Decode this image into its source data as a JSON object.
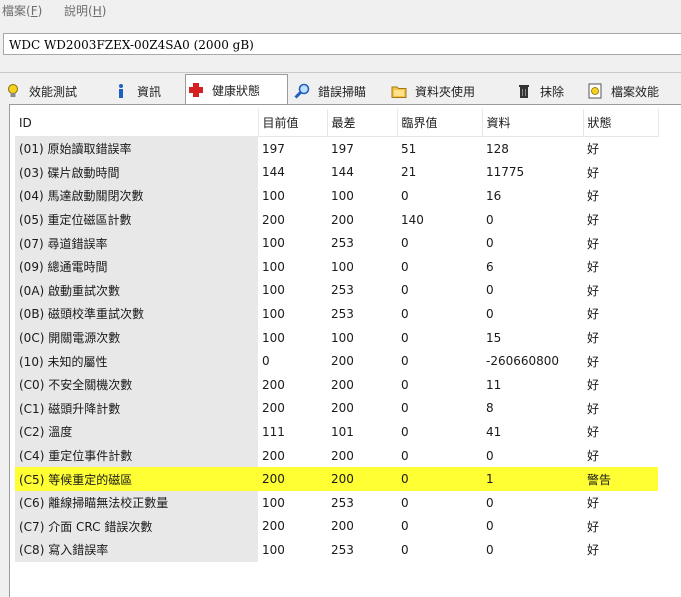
{
  "menu": [
    {
      "label": "檔案(",
      "hotkey": "F",
      "suffix": ")"
    },
    {
      "label": "說明(",
      "hotkey": "H",
      "suffix": ")"
    }
  ],
  "drive": {
    "name": "WDC WD2003FZEX-00Z4SA0 (2000 gB)"
  },
  "tabs": [
    {
      "label": "效能測試",
      "icon": "lightbulb-icon",
      "active": false
    },
    {
      "label": "資訊",
      "icon": "info-icon",
      "active": false
    },
    {
      "label": "健康狀態",
      "icon": "red-cross-icon",
      "active": true
    },
    {
      "label": "錯誤掃瞄",
      "icon": "magnifier-icon",
      "active": false
    },
    {
      "label": "資料夾使用",
      "icon": "folder-icon",
      "active": false
    },
    {
      "label": "抹除",
      "icon": "trash-icon",
      "active": false
    },
    {
      "label": "檔案效能",
      "icon": "file-benchmark-icon",
      "active": false
    }
  ],
  "table": {
    "headers": [
      "ID",
      "目前值",
      "最差",
      "臨界值",
      "資料",
      "狀態"
    ],
    "rows": [
      {
        "id": "(01) 原始讀取錯誤率",
        "current": "197",
        "worst": "197",
        "threshold": "51",
        "raw": "128",
        "status": "好",
        "warning": false
      },
      {
        "id": "(03) 碟片啟動時間",
        "current": "144",
        "worst": "144",
        "threshold": "21",
        "raw": "11775",
        "status": "好",
        "warning": false
      },
      {
        "id": "(04) 馬達啟動關閉次數",
        "current": "100",
        "worst": "100",
        "threshold": "0",
        "raw": "16",
        "status": "好",
        "warning": false
      },
      {
        "id": "(05) 重定位磁區計數",
        "current": "200",
        "worst": "200",
        "threshold": "140",
        "raw": "0",
        "status": "好",
        "warning": false
      },
      {
        "id": "(07) 尋道錯誤率",
        "current": "100",
        "worst": "253",
        "threshold": "0",
        "raw": "0",
        "status": "好",
        "warning": false
      },
      {
        "id": "(09) 總通電時間",
        "current": "100",
        "worst": "100",
        "threshold": "0",
        "raw": "6",
        "status": "好",
        "warning": false
      },
      {
        "id": "(0A) 啟動重試次數",
        "current": "100",
        "worst": "253",
        "threshold": "0",
        "raw": "0",
        "status": "好",
        "warning": false
      },
      {
        "id": "(0B) 磁頭校準重試次數",
        "current": "100",
        "worst": "253",
        "threshold": "0",
        "raw": "0",
        "status": "好",
        "warning": false
      },
      {
        "id": "(0C) 開關電源次數",
        "current": "100",
        "worst": "100",
        "threshold": "0",
        "raw": "15",
        "status": "好",
        "warning": false
      },
      {
        "id": "(10) 未知的屬性",
        "current": "0",
        "worst": "200",
        "threshold": "0",
        "raw": "-260660800",
        "status": "好",
        "warning": false
      },
      {
        "id": "(C0) 不安全關機次數",
        "current": "200",
        "worst": "200",
        "threshold": "0",
        "raw": "11",
        "status": "好",
        "warning": false
      },
      {
        "id": "(C1) 磁頭升降計數",
        "current": "200",
        "worst": "200",
        "threshold": "0",
        "raw": "8",
        "status": "好",
        "warning": false
      },
      {
        "id": "(C2) 溫度",
        "current": "111",
        "worst": "101",
        "threshold": "0",
        "raw": "41",
        "status": "好",
        "warning": false
      },
      {
        "id": "(C4) 重定位事件計數",
        "current": "200",
        "worst": "200",
        "threshold": "0",
        "raw": "0",
        "status": "好",
        "warning": false
      },
      {
        "id": "(C5) 等候重定的磁區",
        "current": "200",
        "worst": "200",
        "threshold": "0",
        "raw": "1",
        "status": "警告",
        "warning": true
      },
      {
        "id": "(C6) 離線掃瞄無法校正數量",
        "current": "100",
        "worst": "253",
        "threshold": "0",
        "raw": "0",
        "status": "好",
        "warning": false
      },
      {
        "id": "(C7) 介面 CRC 錯誤次數",
        "current": "200",
        "worst": "200",
        "threshold": "0",
        "raw": "0",
        "status": "好",
        "warning": false
      },
      {
        "id": "(C8) 寫入錯誤率",
        "current": "100",
        "worst": "253",
        "threshold": "0",
        "raw": "0",
        "status": "好",
        "warning": false
      }
    ]
  },
  "colors": {
    "warning_row": "#ffff33",
    "id_column": "#e8e8e8",
    "accent_red": "#d42020"
  }
}
